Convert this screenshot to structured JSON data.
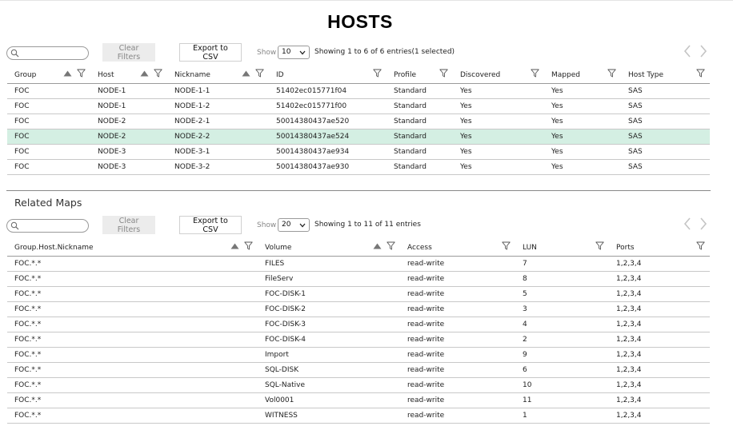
{
  "page": {
    "title": "HOSTS"
  },
  "hosts": {
    "search": {
      "value": "",
      "placeholder": ""
    },
    "clear_filters_label": "Clear Filters",
    "export_label": "Export to CSV",
    "show_label": "Show",
    "page_size": "10",
    "entries_info": "Showing 1 to 6 of 6 entries(1 selected)",
    "columns": [
      "Group",
      "Host",
      "Nickname",
      "ID",
      "Profile",
      "Discovered",
      "Mapped",
      "Host Type"
    ],
    "rows": [
      [
        "FOC",
        "NODE-1",
        "NODE-1-1",
        "51402ec015771f04",
        "Standard",
        "Yes",
        "Yes",
        "SAS"
      ],
      [
        "FOC",
        "NODE-1",
        "NODE-1-2",
        "51402ec015771f00",
        "Standard",
        "Yes",
        "Yes",
        "SAS"
      ],
      [
        "FOC",
        "NODE-2",
        "NODE-2-1",
        "50014380437ae520",
        "Standard",
        "Yes",
        "Yes",
        "SAS"
      ],
      [
        "FOC",
        "NODE-2",
        "NODE-2-2",
        "50014380437ae524",
        "Standard",
        "Yes",
        "Yes",
        "SAS"
      ],
      [
        "FOC",
        "NODE-3",
        "NODE-3-1",
        "50014380437ae934",
        "Standard",
        "Yes",
        "Yes",
        "SAS"
      ],
      [
        "FOC",
        "NODE-3",
        "NODE-3-2",
        "50014380437ae930",
        "Standard",
        "Yes",
        "Yes",
        "SAS"
      ]
    ],
    "selected_row": 3
  },
  "related_maps": {
    "title": "Related Maps",
    "search": {
      "value": "",
      "placeholder": ""
    },
    "clear_filters_label": "Clear Filters",
    "export_label": "Export to CSV",
    "show_label": "Show",
    "page_size": "20",
    "entries_info": "Showing 1 to 11 of 11 entries",
    "columns": [
      "Group.Host.Nickname",
      "Volume",
      "Access",
      "LUN",
      "Ports"
    ],
    "rows": [
      [
        "FOC.*.*",
        "FILES",
        "read-write",
        "7",
        "1,2,3,4"
      ],
      [
        "FOC.*.*",
        "FileServ",
        "read-write",
        "8",
        "1,2,3,4"
      ],
      [
        "FOC.*.*",
        "FOC-DISK-1",
        "read-write",
        "5",
        "1,2,3,4"
      ],
      [
        "FOC.*.*",
        "FOC-DISK-2",
        "read-write",
        "3",
        "1,2,3,4"
      ],
      [
        "FOC.*.*",
        "FOC-DISK-3",
        "read-write",
        "4",
        "1,2,3,4"
      ],
      [
        "FOC.*.*",
        "FOC-DISK-4",
        "read-write",
        "2",
        "1,2,3,4"
      ],
      [
        "FOC.*.*",
        "Import",
        "read-write",
        "9",
        "1,2,3,4"
      ],
      [
        "FOC.*.*",
        "SQL-DISK",
        "read-write",
        "6",
        "1,2,3,4"
      ],
      [
        "FOC.*.*",
        "SQL-Native",
        "read-write",
        "10",
        "1,2,3,4"
      ],
      [
        "FOC.*.*",
        "Vol0001",
        "read-write",
        "11",
        "1,2,3,4"
      ],
      [
        "FOC.*.*",
        "WITNESS",
        "read-write",
        "1",
        "1,2,3,4"
      ]
    ]
  },
  "colors": {
    "selected_row": "#d4efe3",
    "clear_button_bg": "#ececec",
    "pager_arrow": "#c4c4c4"
  },
  "icons": [
    "search-icon",
    "filter-icon",
    "sort-asc-icon",
    "chevron-down-icon",
    "chevron-left-icon",
    "chevron-right-icon"
  ]
}
